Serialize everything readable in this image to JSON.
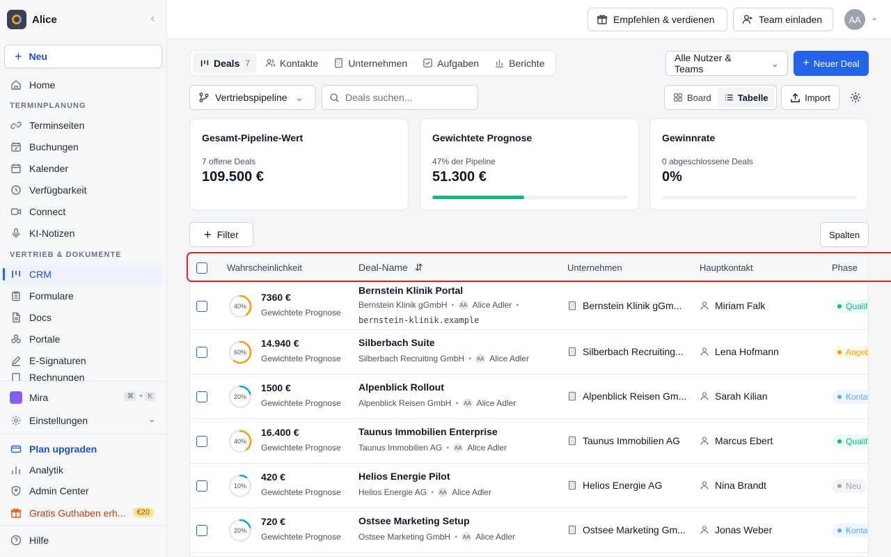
{
  "sidebar": {
    "workspace": "Alice",
    "new_label": "Neu",
    "home": "Home",
    "section_scheduling": "TERMINPLANUNG",
    "scheduling": [
      "Terminseiten",
      "Buchungen",
      "Kalender",
      "Verfügbarkeit",
      "Connect",
      "KI-Notizen"
    ],
    "section_sales": "VERTRIEB & DOKUMENTE",
    "sales": [
      "CRM",
      "Formulare",
      "Docs",
      "Portale",
      "E-Signaturen",
      "Rechnungen"
    ],
    "mira": "Mira",
    "shortcut": [
      "⌘",
      "+",
      "K"
    ],
    "settings": "Einstellungen",
    "plan": "Plan upgraden",
    "analytics": "Analytik",
    "admin": "Admin Center",
    "credit": "Gratis Guthaben erh...",
    "credit_badge": "€20",
    "help": "Hilfe"
  },
  "topbar": {
    "refer": "Empfehlen & verdienen",
    "invite": "Team einladen",
    "avatar": "AA"
  },
  "tabs": [
    {
      "label": "Deals",
      "count": "7"
    },
    {
      "label": "Kontakte"
    },
    {
      "label": "Unternehmen"
    },
    {
      "label": "Aufgaben"
    },
    {
      "label": "Berichte"
    }
  ],
  "toolbar": {
    "owner_filter": "Alle Nutzer & Teams",
    "new_deal": "Neuer Deal",
    "pipeline": "Vertriebspipeline",
    "search_placeholder": "Deals suchen...",
    "board": "Board",
    "table": "Tabelle",
    "import": "Import",
    "filter": "Filter",
    "columns": "Spalten"
  },
  "cards": [
    {
      "title": "Gesamt-Pipeline-Wert",
      "sub": "7 offene Deals",
      "value": "109.500 €"
    },
    {
      "title": "Gewichtete Prognose",
      "sub": "47% der Pipeline",
      "value": "51.300 €",
      "progress": 0.47
    },
    {
      "title": "Gewinnrate",
      "sub": "0 abgeschlossene Deals",
      "value": "0%",
      "progress": 0
    }
  ],
  "table": {
    "headers": [
      "Wahrscheinlichkeit",
      "Deal-Name",
      "Unternehmen",
      "Hauptkontakt",
      "Phase"
    ],
    "sub_label": "Gewichtete Prognose",
    "rows": [
      {
        "pct": "40%",
        "p": 0.4,
        "color": "#f59e0b",
        "amount": "7360 €",
        "name": "Bernstein Klinik Portal",
        "company": "Bernstein Klinik gGmbH",
        "company_short": "Bernstein Klinik gGm...",
        "owner": "Alice Adler",
        "domain": "bernstein-klinik.example",
        "contact": "Miriam Falk",
        "phase": "Qualifi",
        "phase_style": "ph-green"
      },
      {
        "pct": "60%",
        "p": 0.6,
        "color": "#f59e0b",
        "amount": "14.940 €",
        "name": "Silberbach Suite",
        "company": "Silberbach Recruiting GmbH",
        "company_short": "Silberbach Recruiting...",
        "owner": "Alice Adler",
        "contact": "Lena Hofmann",
        "phase": "Angeb",
        "phase_style": "ph-amber"
      },
      {
        "pct": "20%",
        "p": 0.2,
        "color": "#0ea5e9",
        "amount": "1500 €",
        "name": "Alpenblick Rollout",
        "company": "Alpenblick Reisen GmbH",
        "company_short": "Alpenblick Reisen Gm...",
        "owner": "Alice Adler",
        "contact": "Sarah Kilian",
        "phase": "Konta",
        "phase_style": "ph-blue"
      },
      {
        "pct": "40%",
        "p": 0.4,
        "color": "#f59e0b",
        "amount": "16.400 €",
        "name": "Taunus Immobilien Enterprise",
        "company": "Taunus Immobilien AG",
        "company_short": "Taunus Immobilien AG",
        "owner": "Alice Adler",
        "contact": "Marcus Ebert",
        "phase": "Qualifi",
        "phase_style": "ph-green"
      },
      {
        "pct": "10%",
        "p": 0.1,
        "color": "#0ea5e9",
        "amount": "420 €",
        "name": "Helios Energie Pilot",
        "company": "Helios Energie AG",
        "company_short": "Helios Energie AG",
        "owner": "Alice Adler",
        "contact": "Nina Brandt",
        "phase": "Neu",
        "phase_style": "ph-gray"
      },
      {
        "pct": "20%",
        "p": 0.2,
        "color": "#0ea5e9",
        "amount": "720 €",
        "name": "Ostsee Marketing Setup",
        "company": "Ostsee Marketing GmbH",
        "company_short": "Ostsee Marketing Gm...",
        "owner": "Alice Adler",
        "contact": "Jonas Weber",
        "phase": "Konta",
        "phase_style": "ph-blue"
      }
    ]
  }
}
